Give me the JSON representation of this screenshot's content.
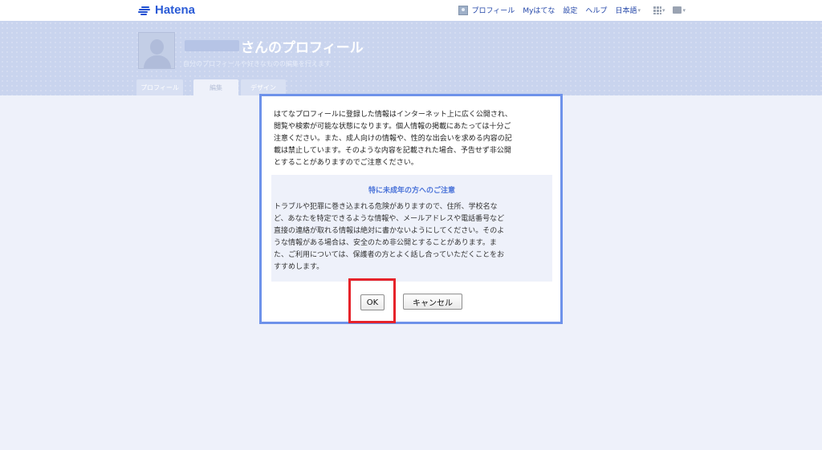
{
  "brand": {
    "name": "Hatena"
  },
  "nav": {
    "profile": "プロフィール",
    "my_hatena": "Myはてな",
    "settings": "設定",
    "help": "ヘルプ",
    "language": "日本語"
  },
  "header": {
    "title": "さんのプロフィール",
    "subtitle": "自分のプロフィールや好きなものの編集を行えます"
  },
  "tabs": [
    {
      "label": "プロフィール"
    },
    {
      "label": "編集"
    },
    {
      "label": "デザイン"
    }
  ],
  "dialog": {
    "intro_lines": [
      "はてなプロフィールに登録した情報はインターネット上に広く公開され、",
      "閲覧や検索が可能な状態になります。個人情報の掲載にあたっては十分ご",
      "注意ください。また、成人向けの情報や、性的な出会いを求める内容の記",
      "載は禁止しています。そのような内容を記載された場合、予告せず非公開",
      "とすることがありますのでご注意ください。"
    ],
    "notice_title": "特に未成年の方へのご注意",
    "notice_lines": [
      "トラブルや犯罪に巻き込まれる危険がありますので、住所、学校名な",
      "ど、あなたを特定できるような情報や、メールアドレスや電話番号など",
      "直接の連絡が取れる情報は絶対に書かないようにしてください。そのよ",
      "うな情報がある場合は、安全のため非公開とすることがあります。ま",
      "た、ご利用については、保護者の方とよく話し合っていただくことをお",
      "すすめします。"
    ],
    "ok_label": "OK",
    "cancel_label": "キャンセル"
  },
  "colors": {
    "accent": "#4a73d9",
    "dialog_border": "#6e92ea",
    "highlight": "#e6232a"
  }
}
